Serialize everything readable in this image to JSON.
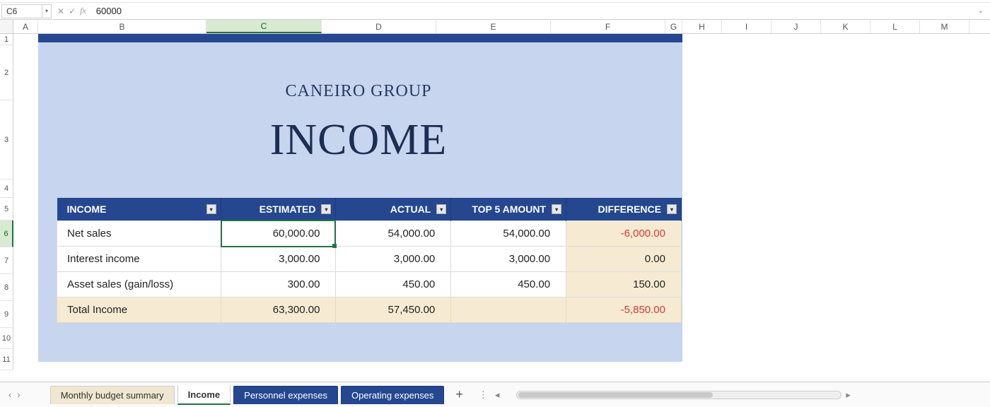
{
  "nameBox": "C6",
  "formula": "60000",
  "columns": [
    "A",
    "B",
    "C",
    "D",
    "E",
    "F",
    "G",
    "H",
    "I",
    "J",
    "K",
    "L",
    "M"
  ],
  "rows": [
    "1",
    "2",
    "3",
    "4",
    "5",
    "6",
    "7",
    "8",
    "9",
    "10",
    "11"
  ],
  "activeCol": "C",
  "activeRow": "6",
  "company": "CANEIRO GROUP",
  "title": "INCOME",
  "tableHeaders": {
    "income": "INCOME",
    "estimated": "ESTIMATED",
    "actual": "ACTUAL",
    "top5": "TOP 5 AMOUNT",
    "difference": "DIFFERENCE"
  },
  "tableRows": [
    {
      "label": "Net sales",
      "estimated": "60,000.00",
      "actual": "54,000.00",
      "top5": "54,000.00",
      "difference": "-6,000.00",
      "neg": true
    },
    {
      "label": "Interest income",
      "estimated": "3,000.00",
      "actual": "3,000.00",
      "top5": "3,000.00",
      "difference": "0.00",
      "neg": false
    },
    {
      "label": "Asset sales (gain/loss)",
      "estimated": "300.00",
      "actual": "450.00",
      "top5": "450.00",
      "difference": "150.00",
      "neg": false
    }
  ],
  "totalRow": {
    "label": "Total Income",
    "estimated": "63,300.00",
    "actual": "57,450.00",
    "top5": "",
    "difference": "-5,850.00",
    "neg": true
  },
  "sheetTabs": {
    "prev": "Monthly budget summary",
    "active": "Income",
    "dark1": "Personnel expenses",
    "dark2": "Operating expenses"
  }
}
